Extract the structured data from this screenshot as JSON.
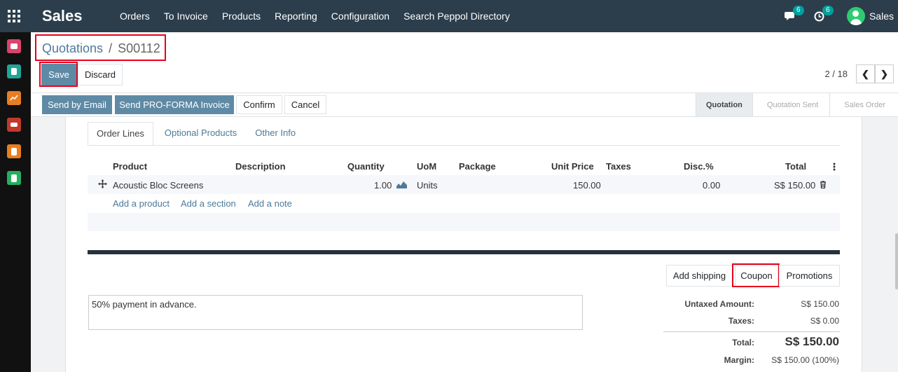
{
  "app": {
    "title": "Sales"
  },
  "menu": [
    "Orders",
    "To Invoice",
    "Products",
    "Reporting",
    "Configuration",
    "Search Peppol Directory"
  ],
  "systray": {
    "messages_count": "6",
    "activities_count": "6",
    "user": "Sales"
  },
  "breadcrumb": {
    "parent": "Quotations",
    "separator": "/",
    "current": "S00112"
  },
  "buttons": {
    "save": "Save",
    "discard": "Discard"
  },
  "pager": {
    "value": "2 / 18"
  },
  "actions": [
    "Send by Email",
    "Send PRO-FORMA Invoice",
    "Confirm",
    "Cancel"
  ],
  "status": {
    "stages": [
      "Quotation",
      "Quotation Sent",
      "Sales Order"
    ],
    "active": "Quotation"
  },
  "tabs": [
    "Order Lines",
    "Optional Products",
    "Other Info"
  ],
  "table": {
    "columns": [
      "Product",
      "Description",
      "Quantity",
      "UoM",
      "Package",
      "Unit Price",
      "Taxes",
      "Disc.%",
      "Total"
    ],
    "rows": [
      {
        "product": "Acoustic Bloc Screens",
        "description": "",
        "quantity": "1.00",
        "uom": "Units",
        "package": "",
        "unit_price": "150.00",
        "taxes": "",
        "discount": "0.00",
        "total": "S$ 150.00"
      }
    ],
    "add_links": [
      "Add a product",
      "Add a section",
      "Add a note"
    ]
  },
  "sale_buttons": [
    "Add shipping",
    "Coupon",
    "Promotions"
  ],
  "note": "50% payment in advance.",
  "totals": {
    "untaxed_label": "Untaxed Amount:",
    "untaxed": "S$ 150.00",
    "taxes_label": "Taxes:",
    "taxes": "S$ 0.00",
    "total_label": "Total:",
    "total": "S$ 150.00",
    "margin_label": "Margin:",
    "margin": "S$ 150.00 (100%)"
  },
  "colors": {
    "navbar": "#2c3e4c",
    "primary": "#5f8aa5",
    "link": "#4d7a99",
    "highlight": "#e8001c"
  }
}
